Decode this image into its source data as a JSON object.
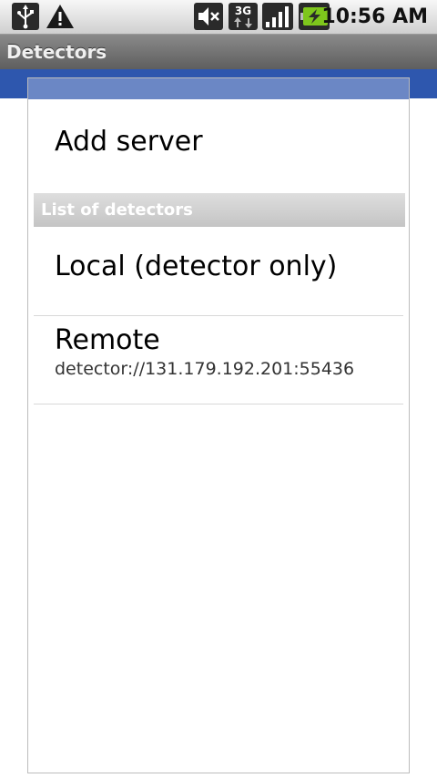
{
  "status_bar": {
    "time": "10:56 AM",
    "network_label": "3G",
    "icons": [
      "usb-icon",
      "warning-icon",
      "mute-icon",
      "network-3g-icon",
      "signal-icon",
      "battery-charging-icon"
    ]
  },
  "title_bar": {
    "title": "Detectors"
  },
  "list": {
    "add_server_label": "Add server",
    "section_header": "List of detectors",
    "items": [
      {
        "title": "Local (detector only)",
        "subtitle": ""
      },
      {
        "title": "Remote",
        "subtitle": "detector://131.179.192.201:55436"
      }
    ]
  },
  "colors": {
    "accent_blue": "#2e57ae",
    "battery_green": "#7ec61c"
  }
}
